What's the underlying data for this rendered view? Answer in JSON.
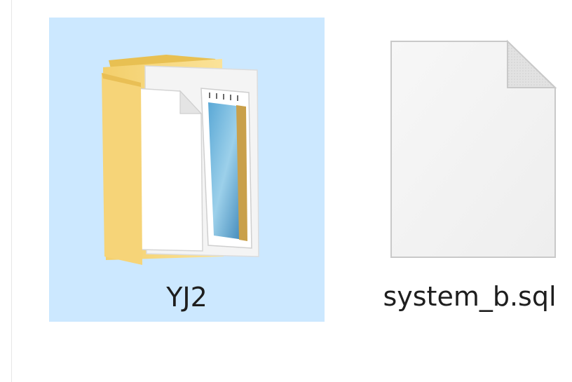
{
  "files": [
    {
      "name": "YJ2",
      "type": "folder",
      "icon": "folder-icon",
      "selected": true
    },
    {
      "name": "system_b.sql",
      "type": "file",
      "icon": "blank-document-icon",
      "selected": false
    }
  ],
  "colors": {
    "selection": "#cce8ff",
    "folder": "#f7d77a",
    "folder_dark": "#e9c35a",
    "page": "#f2f2f2",
    "text": "#1e1e1e"
  }
}
